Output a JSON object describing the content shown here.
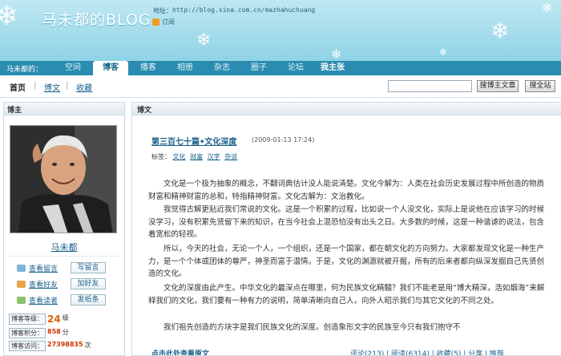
{
  "header": {
    "title": "马未都的BLOG",
    "url_label": "地址：",
    "url": "http://blog.sina.com.cn/mazhahuchuang",
    "subscribe": "订阅"
  },
  "nav": {
    "owner": "马未都的：",
    "items": [
      "空间",
      "博客",
      "播客",
      "相册",
      "杂志",
      "圈子",
      "论坛",
      "我主张"
    ]
  },
  "subnav": {
    "links": [
      "首页",
      "博文",
      "收藏"
    ],
    "search_button": "搜博主文章",
    "site_button": "搜全站"
  },
  "sidebar": {
    "header": "博主",
    "owner_name": "马未都",
    "links": [
      "查看留言",
      "查看好友",
      "查看读者"
    ],
    "buttons": [
      "写留言",
      "加好友",
      "发纸条"
    ],
    "stats": [
      {
        "label": "博客等级：",
        "value": "24",
        "suffix": "级"
      },
      {
        "label": "博客积分：",
        "value": "858",
        "suffix": "分"
      },
      {
        "label": "博客访问：",
        "value": "27398835",
        "suffix": "次"
      }
    ]
  },
  "main": {
    "header": "博文",
    "post_title": "第三百七十篇•文化深度",
    "post_date": "(2009-01-13 17:24)",
    "tags_label": "标签：",
    "tags": [
      "文化",
      "财富",
      "汉字",
      "杂谈"
    ],
    "paragraphs": [
      "文化是一个极为抽象的概念，不翻词典估计没人能说清楚。文化今解为：人类在社会历史发展过程中所创造的物质财富和精神财富的总和，特指精神财富。文化古解为：文治教化。",
      "我觉得古解更贴近我们常说的文化。这是一个积累的过程，比如说一个人没文化，实际上是说他在应该学习的时候没学习，没有积累先贤留下来的知识，在当今社会上混恐怕没有出头之日。大多数的时候，这是一种谐谑的说法，包含着宽松的轻视。",
      "所以，今天的社会，无论一个人，一个组织，还是一个国家，都在朝文化的方向努力。大家都发现文化是一种生产力，是一个个体或团体的尊严，神圣而富于温情。于是，文化的渊源就被开掘，所有的后来者都向纵深发掘自己先贤创造的文化。",
      "文化的深度由此产生。中华文化的最深点在哪里，何为民族文化精髓？我们不能老是用“博大精深，浩如烟海”来解释我们的文化，我们要有一种有力的说明，简单清晰向自己人，向外人昭示我们与其它文化的不同之处。",
      "我们祖先创造的方块字是我们民族文化的深度。创造象形文字的民族至今只有我们抱守不"
    ],
    "footer_link": "点击此处查看原文",
    "footer_right": "评论(213) | 阅读(6314) | 收藏(5) | 分享 | 推荐"
  }
}
